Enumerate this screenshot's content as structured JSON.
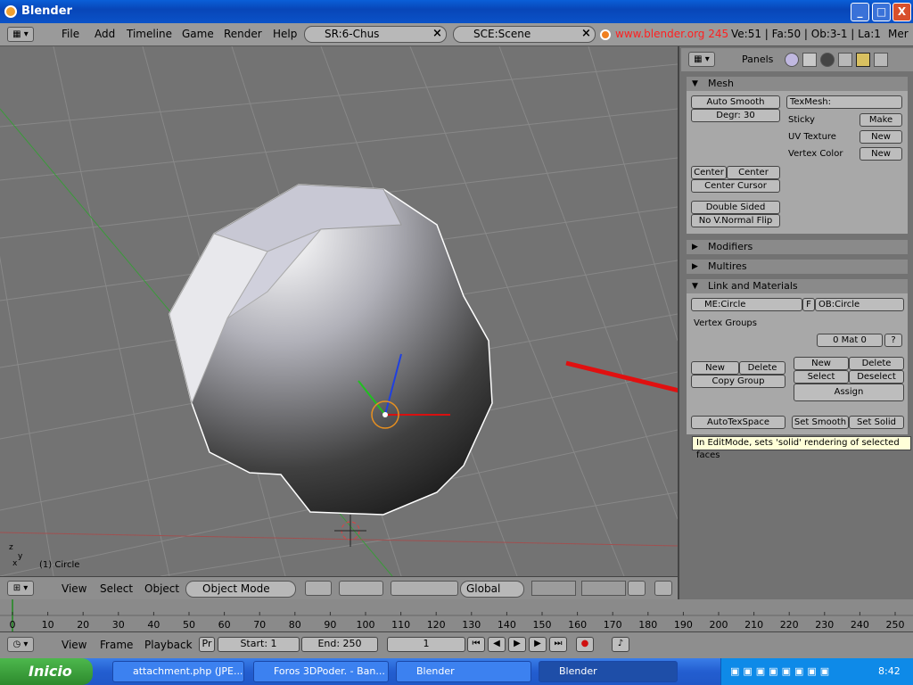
{
  "window": {
    "title": "Blender",
    "minimize": "_",
    "maximize": "□",
    "close": "X"
  },
  "menu": {
    "items": [
      "File",
      "Add",
      "Timeline",
      "Game",
      "Render",
      "Help"
    ],
    "screen_field": "SR:6-Chus",
    "scene_field": "SCE:Scene",
    "url": "www.blender.org 245",
    "stats": "Ve:51 | Fa:50 | Ob:3-1 | La:1",
    "stats_tail": "Mer"
  },
  "panels_header": {
    "label": "Panels"
  },
  "mesh": {
    "title": "Mesh",
    "auto_smooth": "Auto Smooth",
    "degr": "Degr: 30",
    "texmesh": "TexMesh:",
    "sticky": "Sticky",
    "make": "Make",
    "uv_texture": "UV Texture",
    "uv_new": "New",
    "vertex_color": "Vertex Color",
    "vc_new": "New",
    "center": "Center",
    "center_new": "Center New",
    "center_cursor": "Center Cursor",
    "double_sided": "Double Sided",
    "no_vnormal_flip": "No V.Normal Flip"
  },
  "modifiers": {
    "title": "Modifiers"
  },
  "multires": {
    "title": "Multires"
  },
  "link": {
    "title": "Link and Materials",
    "me_field": "ME:Circle",
    "f_btn": "F",
    "ob_field": "OB:Circle",
    "vertex_groups": "Vertex Groups",
    "mat": "0 Mat 0",
    "mat_q": "?",
    "vg_new": "New",
    "vg_delete": "Delete",
    "copy_group": "Copy Group",
    "m_new": "New",
    "m_delete": "Delete",
    "m_select": "Select",
    "m_deselect": "Deselect",
    "assign": "Assign",
    "autotexspace": "AutoTexSpace",
    "set_smooth": "Set Smooth",
    "set_solid": "Set Solid"
  },
  "tooltip": "In EditMode, sets 'solid' rendering of selected faces",
  "viewport": {
    "object_label": "(1) Circle",
    "axis_x": "x",
    "axis_y": "y",
    "axis_z": "z"
  },
  "view_footer": {
    "view": "View",
    "select": "Select",
    "object": "Object",
    "mode": "Object Mode",
    "orientation": "Global"
  },
  "timeline": {
    "ticks": [
      "0",
      "10",
      "20",
      "30",
      "40",
      "50",
      "60",
      "70",
      "80",
      "90",
      "100",
      "110",
      "120",
      "130",
      "140",
      "150",
      "160",
      "170",
      "180",
      "190",
      "200",
      "210",
      "220",
      "230",
      "240",
      "250"
    ]
  },
  "timeline_footer": {
    "view": "View",
    "frame": "Frame",
    "playback": "Playback",
    "pr": "Pr",
    "start": "Start: 1",
    "end": "End: 250",
    "current": "1"
  },
  "taskbar": {
    "start": "Inicio",
    "tasks": [
      "attachment.php (JPE...",
      "Foros 3DPoder. - Ban...",
      "Blender",
      "Blender"
    ],
    "clock": "8:42"
  },
  "colors": {
    "accent_arrow": "#e01010",
    "url_red": "#ff2020",
    "tooltip_bg": "#ffffd8"
  }
}
